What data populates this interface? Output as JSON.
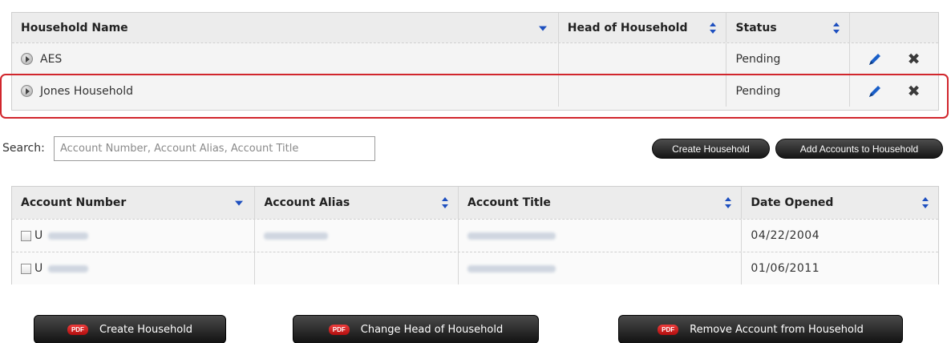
{
  "household_table": {
    "columns": [
      "Household Name",
      "Head of Household",
      "Status",
      ""
    ],
    "rows": [
      {
        "name": "AES",
        "head": "",
        "status": "Pending"
      },
      {
        "name": "Jones Household",
        "head": "",
        "status": "Pending"
      }
    ]
  },
  "search": {
    "label": "Search:",
    "placeholder": "Account Number, Account Alias, Account Title"
  },
  "buttons": {
    "create_household": "Create Household",
    "add_accounts": "Add Accounts to Household"
  },
  "accounts_table": {
    "columns": [
      "Account Number",
      "Account Alias",
      "Account Title",
      "Date Opened"
    ],
    "rows": [
      {
        "number_prefix": "U",
        "date": "04/22/2004"
      },
      {
        "number_prefix": "U",
        "date": "01/06/2011"
      }
    ]
  },
  "pdf_links": {
    "badge": "PDF",
    "create": "Create Household",
    "change_head": "Change Head of Household",
    "remove": "Remove Account from Household"
  },
  "colors": {
    "highlight": "#d1262c",
    "sort_arrow": "#1d4fbf",
    "edit_icon": "#1a5fc8"
  },
  "icons": [
    "expand-icon",
    "edit-pencil-icon",
    "delete-x-icon",
    "sort-icon",
    "checkbox"
  ]
}
